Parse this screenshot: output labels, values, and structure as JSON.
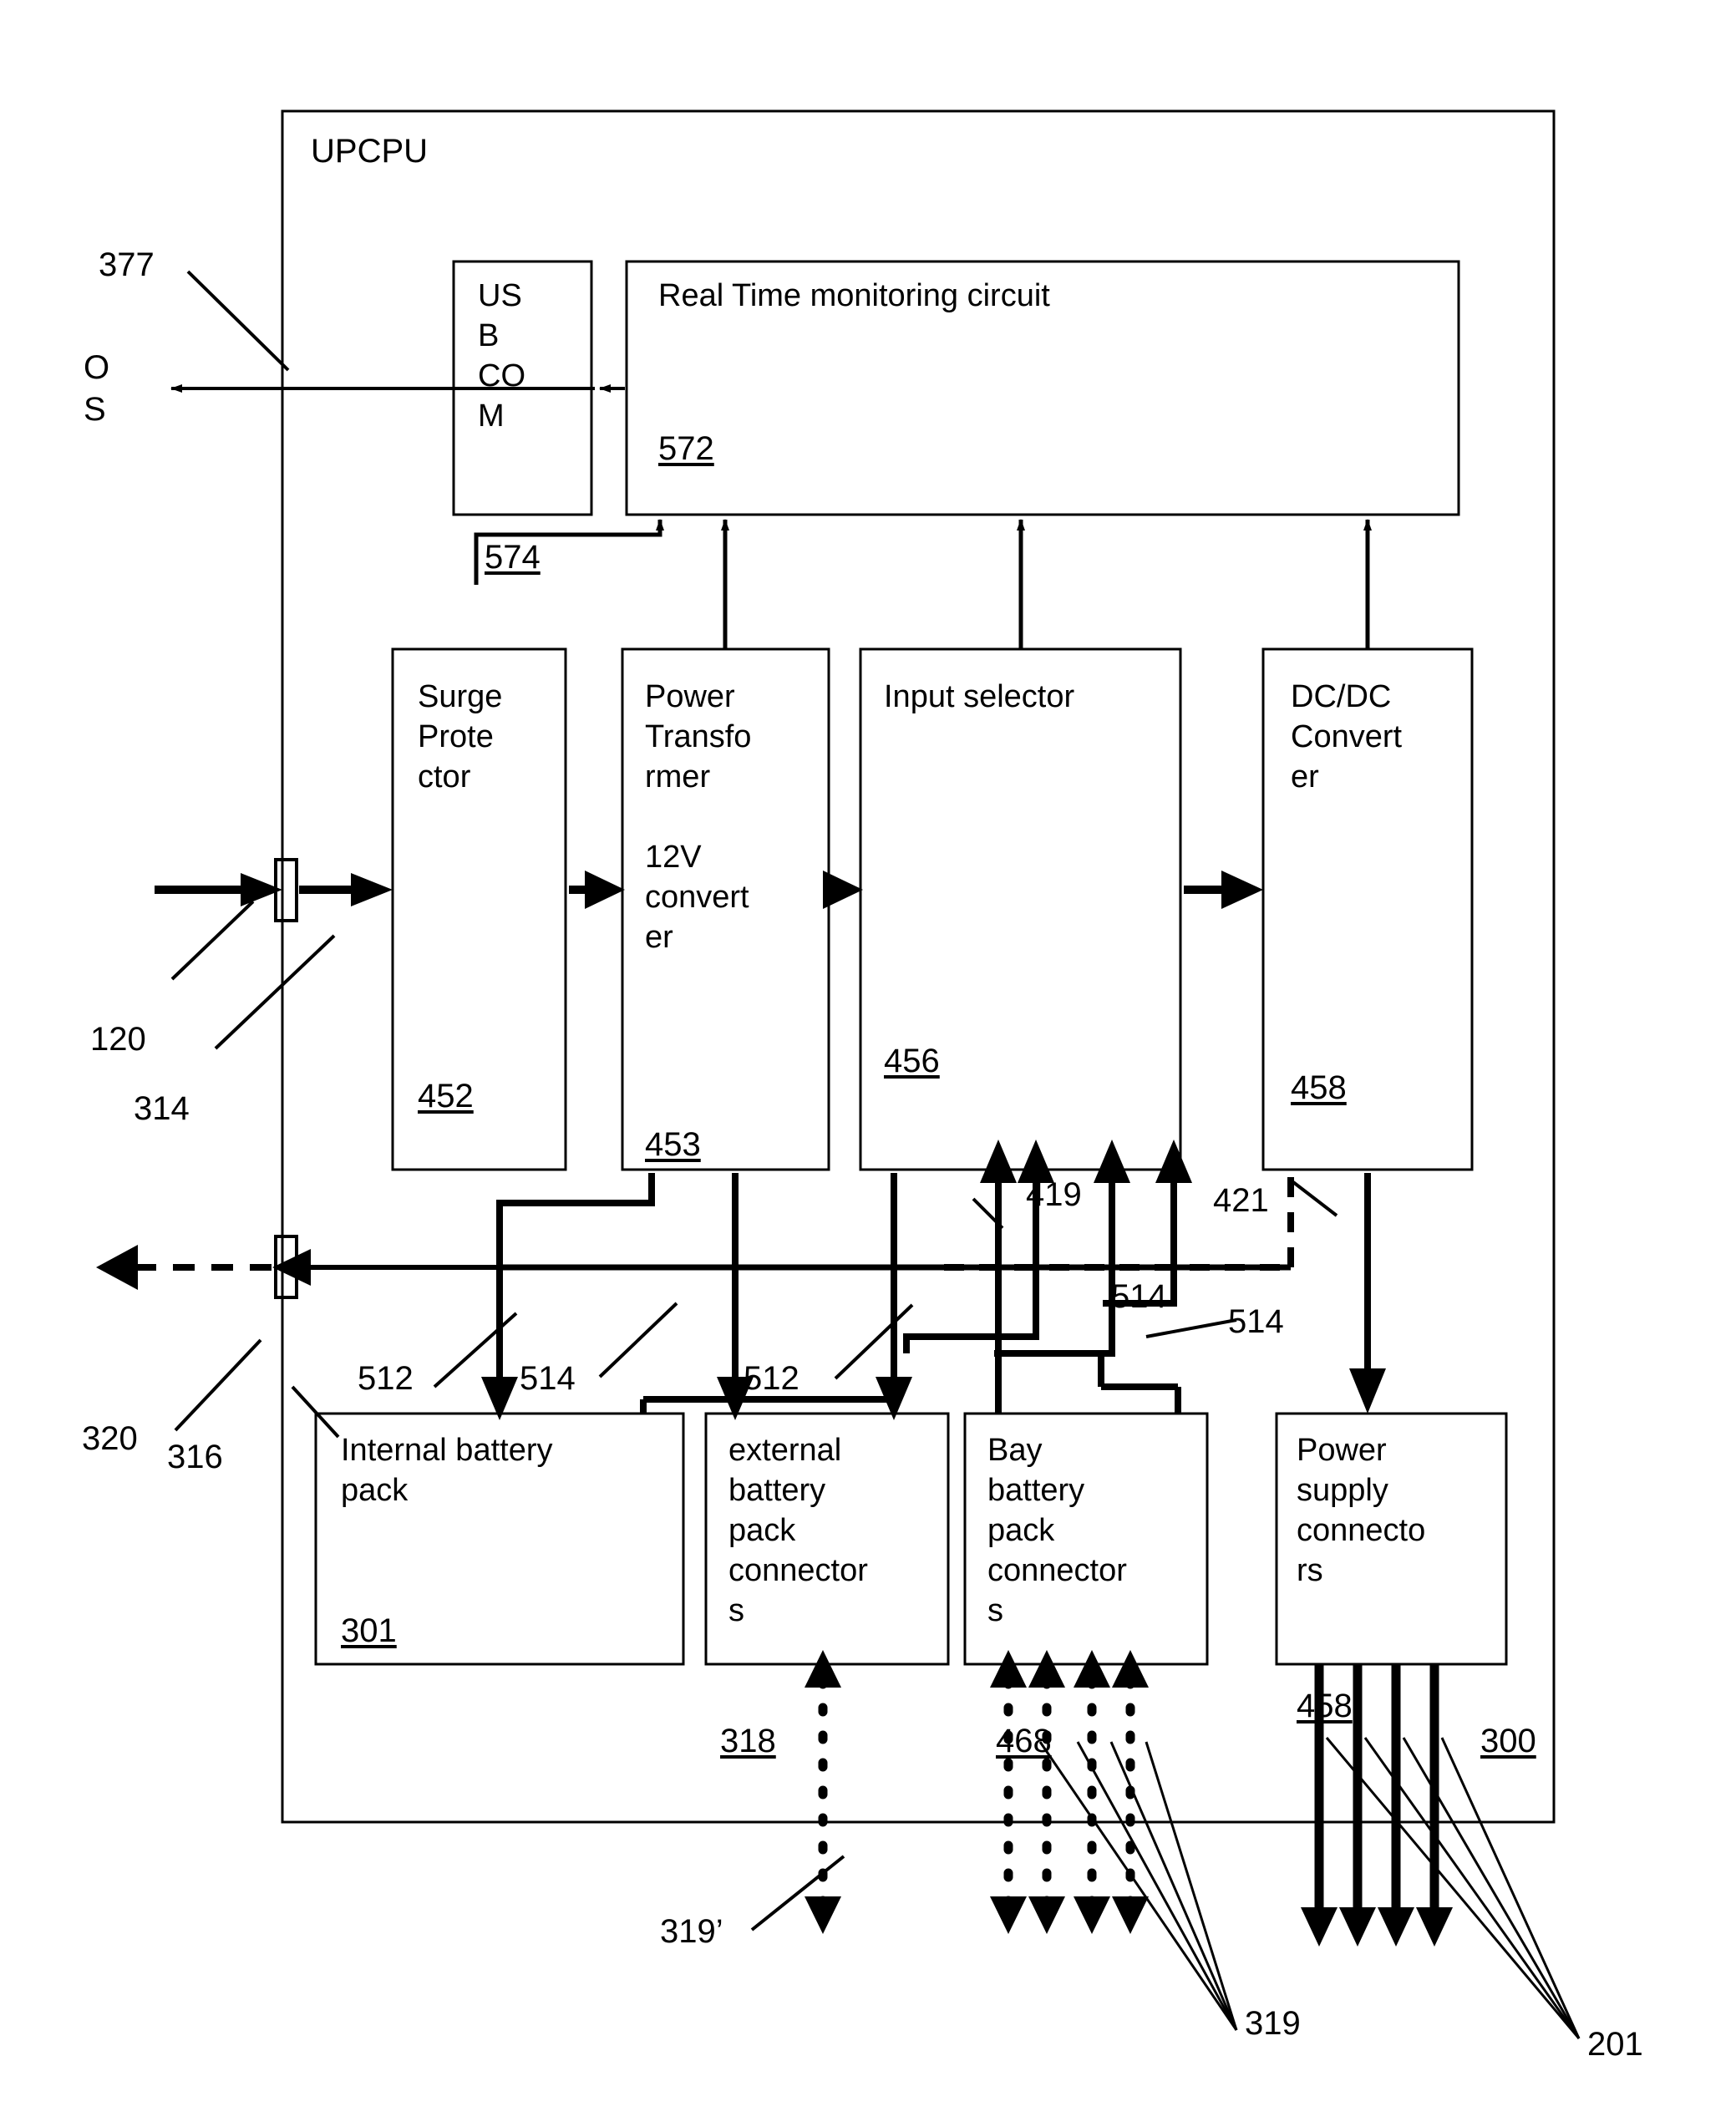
{
  "figure": {
    "outer_container_label": "UPCPU",
    "outer_ref": "300"
  },
  "blocks": [
    {
      "id": "usb_com",
      "name": "usb-com-block",
      "label": "US\nB\nCO\nM",
      "ref": ""
    },
    {
      "id": "rtmc",
      "name": "real-time-monitoring",
      "label": "Real Time monitoring circuit",
      "ref": "572"
    },
    {
      "id": "surge",
      "name": "surge-protector",
      "label": "Surge\nProte\nctor",
      "ref": "452"
    },
    {
      "id": "xformer",
      "name": "power-transformer",
      "label": "Power\nTransfo\nrmer\n\n12V\nconvert\ner",
      "ref": "453"
    },
    {
      "id": "inputsel",
      "name": "input-selector",
      "label": "Input selector",
      "ref": "456"
    },
    {
      "id": "dcdc",
      "name": "dc-dc-converter",
      "label": "DC/DC\nConvert\ner",
      "ref": "458"
    },
    {
      "id": "intbatt",
      "name": "internal-battery-pack",
      "label": "Internal battery\npack",
      "ref": "301"
    },
    {
      "id": "extbatt",
      "name": "external-battery-connectors",
      "label": "external\nbattery\npack\nconnector\ns",
      "ref": ""
    },
    {
      "id": "baybatt",
      "name": "bay-battery-connectors",
      "label": "Bay\nbattery\npack\nconnector\ns",
      "ref": ""
    },
    {
      "id": "pwrsupply",
      "name": "power-supply-connectors",
      "label": "Power\nsupply\nconnecto\nrs",
      "ref": "458"
    }
  ],
  "callouts": [
    {
      "id": "c377",
      "name": "callout-377",
      "text": "377"
    },
    {
      "id": "cos",
      "name": "callout-os",
      "text": "O\nS"
    },
    {
      "id": "c574",
      "name": "callout-574",
      "text": "574"
    },
    {
      "id": "c120",
      "name": "callout-120",
      "text": "120"
    },
    {
      "id": "c314",
      "name": "callout-314",
      "text": "314"
    },
    {
      "id": "c320",
      "name": "callout-320",
      "text": "320"
    },
    {
      "id": "c316",
      "name": "callout-316",
      "text": "316"
    },
    {
      "id": "c419",
      "name": "callout-419",
      "text": "419"
    },
    {
      "id": "c421",
      "name": "callout-421",
      "text": "421"
    },
    {
      "id": "c514a",
      "name": "callout-514-a",
      "text": "514"
    },
    {
      "id": "c512a",
      "name": "callout-512-a",
      "text": "512"
    },
    {
      "id": "c514b",
      "name": "callout-514-b",
      "text": "514"
    },
    {
      "id": "c512b",
      "name": "callout-512-b",
      "text": "512"
    },
    {
      "id": "c514c",
      "name": "callout-514-c",
      "text": "514"
    },
    {
      "id": "c318",
      "name": "callout-318",
      "text": "318"
    },
    {
      "id": "c468",
      "name": "callout-468",
      "text": "468"
    },
    {
      "id": "c458b",
      "name": "callout-458-b",
      "text": "458"
    },
    {
      "id": "c300",
      "name": "callout-300",
      "text": "300"
    },
    {
      "id": "c319p",
      "name": "callout-319-prime",
      "text": "319’"
    },
    {
      "id": "c319",
      "name": "callout-319",
      "text": "319"
    },
    {
      "id": "c201",
      "name": "callout-201",
      "text": "201"
    }
  ],
  "colors": {
    "stroke": "#000000",
    "background": "#ffffff"
  }
}
